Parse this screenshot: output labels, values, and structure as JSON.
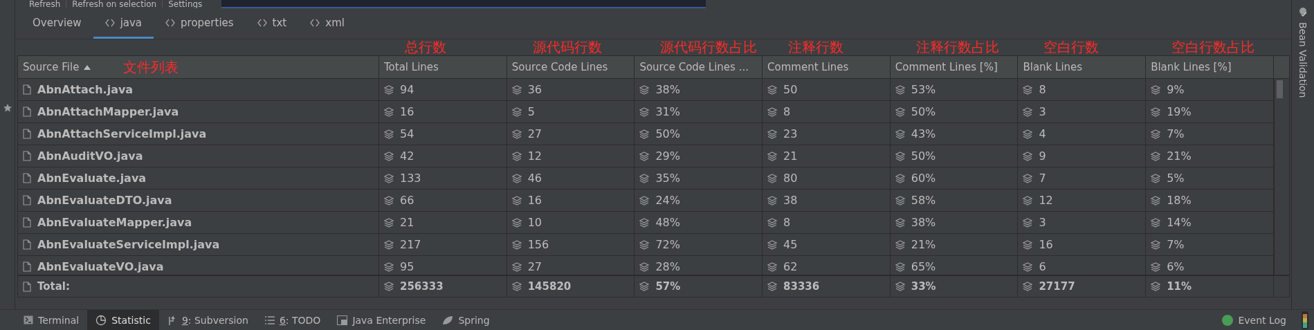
{
  "toolbar": [
    {
      "label": "Refresh"
    },
    {
      "label": "Refresh on selection"
    },
    {
      "label": "Settings"
    }
  ],
  "tabs": [
    {
      "label": "Overview",
      "kind": "overview",
      "selected": false
    },
    {
      "label": "java",
      "kind": "filetype",
      "selected": true
    },
    {
      "label": "properties",
      "kind": "filetype",
      "selected": false
    },
    {
      "label": "txt",
      "kind": "filetype",
      "selected": false
    },
    {
      "label": "xml",
      "kind": "filetype",
      "selected": false
    }
  ],
  "table": {
    "columns": [
      {
        "label": "Source File",
        "annotation": "文件列表",
        "sorted": true
      },
      {
        "label": "Total Lines",
        "annotation": "总行数",
        "sorted": false
      },
      {
        "label": "Source Code Lines",
        "annotation": "源代码行数",
        "sorted": false
      },
      {
        "label": "Source Code Lines ...",
        "annotation": "源代码行数占比",
        "sorted": false
      },
      {
        "label": "Comment Lines",
        "annotation": "注释行数",
        "sorted": false
      },
      {
        "label": "Comment Lines [%]",
        "annotation": "注释行数占比",
        "sorted": false
      },
      {
        "label": "Blank Lines",
        "annotation": "空白行数",
        "sorted": false
      },
      {
        "label": "Blank Lines [%]",
        "annotation": "空白行数占比",
        "sorted": false
      }
    ],
    "rows": [
      {
        "file": "AbnAttach.java",
        "values": [
          "94",
          "36",
          "38%",
          "50",
          "53%",
          "8",
          "9%"
        ]
      },
      {
        "file": "AbnAttachMapper.java",
        "values": [
          "16",
          "5",
          "31%",
          "8",
          "50%",
          "3",
          "19%"
        ]
      },
      {
        "file": "AbnAttachServiceImpl.java",
        "values": [
          "54",
          "27",
          "50%",
          "23",
          "43%",
          "4",
          "7%"
        ]
      },
      {
        "file": "AbnAuditVO.java",
        "values": [
          "42",
          "12",
          "29%",
          "21",
          "50%",
          "9",
          "21%"
        ]
      },
      {
        "file": "AbnEvaluate.java",
        "values": [
          "133",
          "46",
          "35%",
          "80",
          "60%",
          "7",
          "5%"
        ]
      },
      {
        "file": "AbnEvaluateDTO.java",
        "values": [
          "66",
          "16",
          "24%",
          "38",
          "58%",
          "12",
          "18%"
        ]
      },
      {
        "file": "AbnEvaluateMapper.java",
        "values": [
          "21",
          "10",
          "48%",
          "8",
          "38%",
          "3",
          "14%"
        ]
      },
      {
        "file": "AbnEvaluateServiceImpl.java",
        "values": [
          "217",
          "156",
          "72%",
          "45",
          "21%",
          "16",
          "7%"
        ]
      },
      {
        "file": "AbnEvaluateVO.java",
        "values": [
          "95",
          "27",
          "28%",
          "62",
          "65%",
          "6",
          "6%"
        ]
      }
    ],
    "total": {
      "label": "Total:",
      "values": [
        "256333",
        "145820",
        "57%",
        "83336",
        "33%",
        "27177",
        "11%"
      ]
    }
  },
  "bottom_tabs": [
    {
      "label": "Terminal",
      "kind": "terminal",
      "selected": false
    },
    {
      "label": "Statistic",
      "kind": "statistic",
      "selected": true
    },
    {
      "mnemonic": "9",
      "label": ": Subversion",
      "kind": "vcs",
      "selected": false
    },
    {
      "mnemonic": "6",
      "label": ": TODO",
      "kind": "todo",
      "selected": false
    },
    {
      "label": "Java Enterprise",
      "kind": "enterprise",
      "selected": false
    },
    {
      "label": "Spring",
      "kind": "spring",
      "selected": false
    }
  ],
  "event_log": {
    "label": "Event Log"
  },
  "right_sidebar": {
    "label": "Bean Validation"
  }
}
